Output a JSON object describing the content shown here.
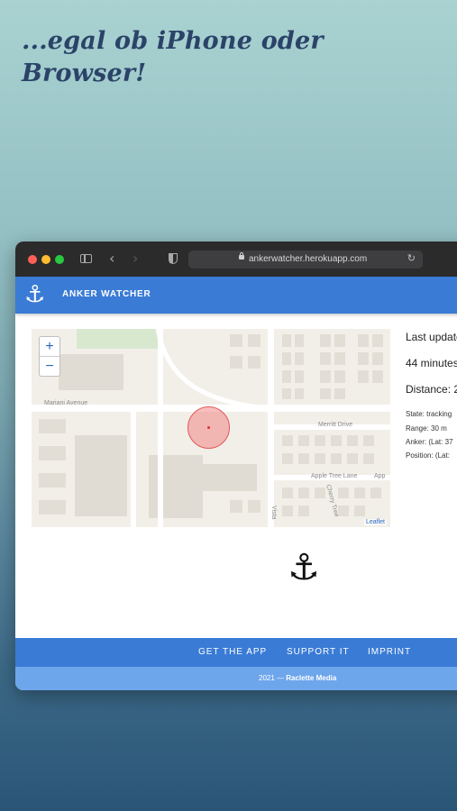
{
  "headline": {
    "line1": "...egal ob iPhone oder",
    "line2": "Browser!"
  },
  "browser": {
    "url": "ankerwatcher.herokuapp.com"
  },
  "app": {
    "title": "ANKER WATCHER",
    "anchor_glyph": "⚓"
  },
  "map": {
    "zoom_in": "+",
    "zoom_out": "−",
    "streets": {
      "mariani": "Mariani Avenue",
      "merritt": "Merritt Drive",
      "appletree": "Apple Tree Lane",
      "appletree2": "App",
      "cherry": "Cherry Tree",
      "vista": "Vista"
    },
    "attribution": "Leaflet"
  },
  "status": {
    "last_update": "Last update",
    "ago": "44 minutes",
    "distance": "Distance: 2",
    "state": "State: tracking",
    "range": "Range: 30 m",
    "anker": "Anker: (Lat: 37",
    "position": "Position: (Lat:"
  },
  "footer": {
    "get_app": "GET THE APP",
    "support": "SUPPORT IT",
    "imprint": "IMPRINT",
    "copyright_prefix": "2021 — ",
    "copyright_owner": "Raclette Media"
  },
  "colors": {
    "brand_blue": "#3a7bd5",
    "footer_light": "#6ea6ec",
    "headline": "#2b4368"
  }
}
